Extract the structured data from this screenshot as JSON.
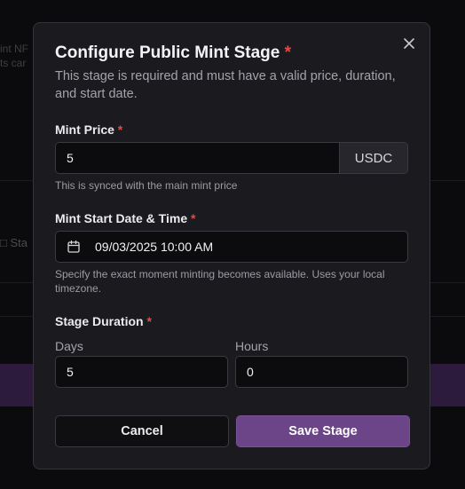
{
  "background": {
    "line1": "int NF",
    "line2": "ts car",
    "calendar_label": "Sta"
  },
  "modal": {
    "title": "Configure Public Mint Stage",
    "required_mark": "*",
    "description": "This stage is required and must have a valid price, duration, and start date.",
    "close_icon": "close-icon"
  },
  "mint_price": {
    "label": "Mint Price",
    "value": "5",
    "currency": "USDC",
    "hint": "This is synced with the main mint price"
  },
  "start_date": {
    "label": "Mint Start Date & Time",
    "value": "09/03/2025 10:00 AM",
    "icon": "calendar-icon",
    "hint": "Specify the exact moment minting becomes available. Uses your local timezone."
  },
  "duration": {
    "label": "Stage Duration",
    "days_label": "Days",
    "days_value": "5",
    "hours_label": "Hours",
    "hours_value": "0"
  },
  "actions": {
    "cancel_label": "Cancel",
    "save_label": "Save Stage"
  },
  "colors": {
    "accent": "#6b4588",
    "required": "#ef4444",
    "modal_bg": "#1b1b1f"
  }
}
